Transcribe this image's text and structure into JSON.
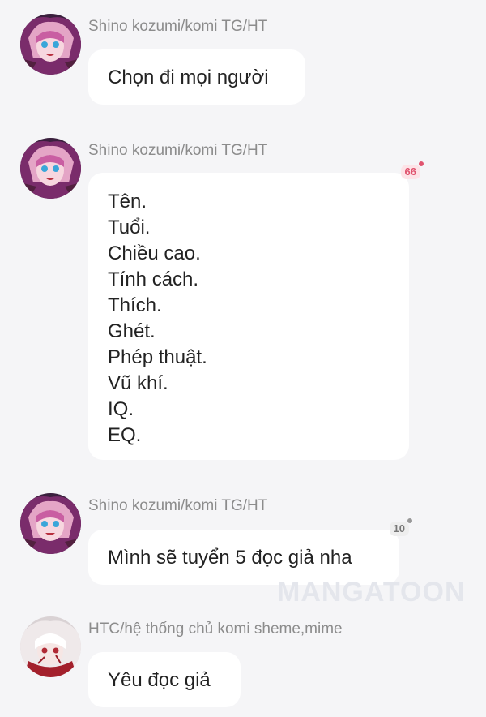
{
  "colors": {
    "background": "#f5f5f7",
    "bubble": "#ffffff",
    "sender_name": "#8c8c8c",
    "message_text": "#222222",
    "badge_pink_bg": "#fde3e7",
    "badge_pink_text": "#e0546f",
    "badge_gray_bg": "#eeeeee",
    "badge_gray_text": "#777777"
  },
  "watermark": "MANGATOON",
  "messages": [
    {
      "sender": "Shino kozumi/komi TG/HT",
      "avatar": "anime-avatar-pink-hair",
      "lines": [
        "Chọn đi mọi người"
      ]
    },
    {
      "sender": "Shino kozumi/komi TG/HT",
      "avatar": "anime-avatar-pink-hair",
      "badge": "66",
      "lines": [
        "Tên.",
        "Tuổi.",
        "Chiều cao.",
        "Tính cách.",
        "Thích.",
        "Ghét.",
        "Phép thuật.",
        "Vũ khí.",
        "IQ.",
        "EQ."
      ]
    },
    {
      "sender": "Shino kozumi/komi TG/HT",
      "avatar": "anime-avatar-pink-hair",
      "badge": "10",
      "lines": [
        "Mình sẽ tuyển 5 đọc giả nha"
      ]
    },
    {
      "sender": "HTC/hệ thống chủ komi sheme,mime",
      "avatar": "anime-avatar-white-hair",
      "lines": [
        "Yêu đọc giả"
      ]
    }
  ]
}
